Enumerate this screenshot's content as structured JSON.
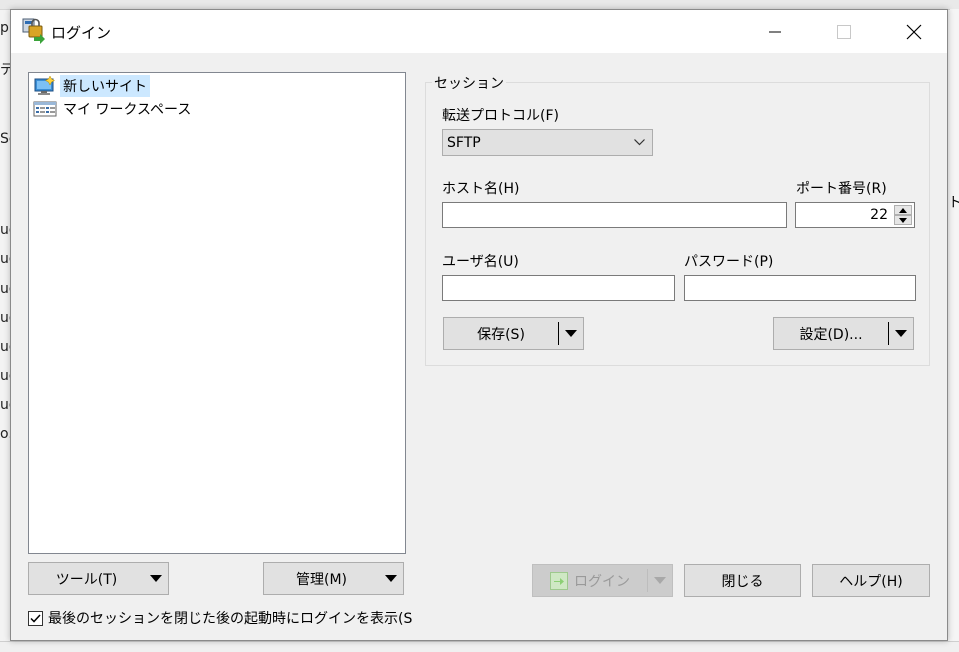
{
  "background": {
    "left_chars": [
      "p",
      "デ",
      "Se",
      "ug",
      "ug",
      "ug",
      "ug",
      "ug",
      "ug",
      "ug",
      "o.l"
    ],
    "right_char": "ト"
  },
  "window": {
    "title": "ログイン",
    "controls": {
      "minimize": "minimize-icon",
      "maximize": "maximize-icon",
      "close": "close-icon"
    }
  },
  "tree": {
    "items": [
      {
        "label": "新しいサイト",
        "icon": "new-site-icon",
        "selected": true
      },
      {
        "label": "マイ ワークスペース",
        "icon": "workspace-icon",
        "selected": false
      }
    ]
  },
  "left_buttons": {
    "tools": "ツール(T)",
    "manage": "管理(M)"
  },
  "checkbox": {
    "label": "最後のセッションを閉じた後の起動時にログインを表示(S",
    "checked": true
  },
  "session": {
    "group_label": "セッション",
    "protocol_label": "転送プロトコル(F)",
    "protocol_value": "SFTP",
    "host_label": "ホスト名(H)",
    "host_value": "",
    "port_label": "ポート番号(R)",
    "port_value": "22",
    "user_label": "ユーザ名(U)",
    "user_value": "",
    "password_label": "パスワード(P)",
    "password_value": "",
    "save_button": "保存(S)",
    "advanced_button": "設定(D)..."
  },
  "footer": {
    "login": "ログイン",
    "login_enabled": false,
    "close": "閉じる",
    "help": "ヘルプ(H)"
  },
  "colors": {
    "selection": "#cce8ff",
    "dialog_bg": "#f0f0f0",
    "button_bg": "#e1e1e1",
    "accent_green": "#5fb83a"
  }
}
